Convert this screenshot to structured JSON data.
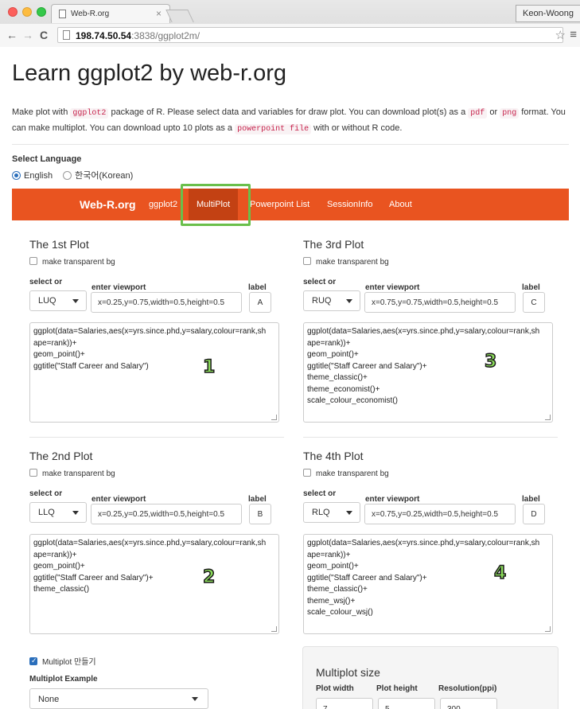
{
  "browser": {
    "tab_title": "Web-R.org",
    "tab_close": "×",
    "profile": "Keon-Woong",
    "back": "←",
    "forward": "→",
    "reload": "C",
    "url_host": "198.74.50.54",
    "url_rest": ":3838/ggplot2m/",
    "star": "☆",
    "menu": "≡"
  },
  "page": {
    "title": "Learn ggplot2 by web-r.org",
    "intro": {
      "t1": "Make plot with ",
      "c1": "ggplot2",
      "t2": " package of R. Please select data and variables for draw plot. You can download plot(s) as a ",
      "c2": "pdf",
      "t3": " or ",
      "c3": "png",
      "t4": " format. You can make multiplot. You can download upto 10 plots as a ",
      "c4": "powerpoint file",
      "t5": " with or without R code."
    },
    "select_language": "Select Language",
    "languages": [
      "English",
      "한국어(Korean)"
    ]
  },
  "appnav": {
    "brand": "Web-R.org",
    "items": [
      "ggplot2",
      "MultiPlot",
      "Powerpoint List",
      "SessionInfo",
      "About"
    ],
    "active": "MultiPlot"
  },
  "labels": {
    "transparent": "make transparent bg",
    "select_or": "select or",
    "enter_viewport": "enter viewport",
    "label": "label"
  },
  "plots": [
    {
      "title": "The 1st Plot",
      "select": "LUQ",
      "viewport": "x=0.25,y=0.75,width=0.5,height=0.5",
      "label": "A",
      "code": [
        "ggplot(data=Salaries,aes(x=yrs.since.phd,y=salary,colour=rank,sh",
        "ape=rank))+",
        " geom_point()+",
        " ggtitle(\"Staff Career and Salary\")"
      ],
      "badge": "1"
    },
    {
      "title": "The 3rd Plot",
      "select": "RUQ",
      "viewport": "x=0.75,y=0.75,width=0.5,height=0.5",
      "label": "C",
      "code": [
        "ggplot(data=Salaries,aes(x=yrs.since.phd,y=salary,colour=rank,sh",
        "ape=rank))+",
        " geom_point()+",
        "ggtitle(\"Staff Career and Salary\")+",
        " theme_classic()+",
        " theme_economist()+",
        " scale_colour_economist()"
      ],
      "badge": "3"
    },
    {
      "title": "The 2nd Plot",
      "select": "LLQ",
      "viewport": "x=0.25,y=0.25,width=0.5,height=0.5",
      "label": "B",
      "code": [
        "ggplot(data=Salaries,aes(x=yrs.since.phd,y=salary,colour=rank,sh",
        "ape=rank))+",
        " geom_point()+",
        " ggtitle(\"Staff Career and Salary\")+",
        " theme_classic()"
      ],
      "badge": "2"
    },
    {
      "title": "The 4th Plot",
      "select": "RLQ",
      "viewport": "x=0.75,y=0.25,width=0.5,height=0.5",
      "label": "D",
      "code": [
        "ggplot(data=Salaries,aes(x=yrs.since.phd,y=salary,colour=rank,sh",
        "ape=rank))+",
        " geom_point()+",
        "ggtitle(\"Staff Career and Salary\")+",
        " theme_classic()+",
        " theme_wsj()+",
        " scale_colour_wsj()"
      ],
      "badge": "4"
    }
  ],
  "multiplot": {
    "checkbox_label": "Multiplot 만들기",
    "example_label": "Multiplot Example",
    "example_value": "None",
    "size_title": "Multiplot size",
    "width_label": "Plot width",
    "height_label": "Plot height",
    "res_label": "Resolution(ppi)",
    "width_value": "7",
    "height_value": "5",
    "res_value": "300"
  },
  "colors": {
    "navbar": "#e95420",
    "navbar_active": "#c34113",
    "highlight": "#6abf4b",
    "badge": "#8bdc5a"
  }
}
